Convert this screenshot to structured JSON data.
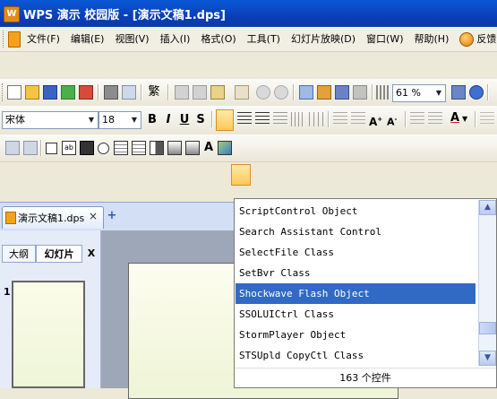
{
  "titlebar": {
    "app_badge": "W",
    "title": "WPS 演示 校园版 - [演示文稿1.dps]"
  },
  "menu": {
    "items": [
      "文件(F)",
      "编辑(E)",
      "视图(V)",
      "插入(I)",
      "格式(O)",
      "工具(T)",
      "幻灯片放映(D)",
      "窗口(W)",
      "帮助(H)"
    ],
    "feedback": "反馈(B)"
  },
  "toolbar1": {
    "glyph_fanti": "繁",
    "zoom_value": "61 %"
  },
  "toolbar2": {
    "font_name": "宋体",
    "font_size": "18",
    "bold": "B",
    "italic": "I",
    "underline": "U",
    "shadow": "S",
    "font_color_glyph": "A"
  },
  "toolbar3": {
    "label_glyph": "A"
  },
  "tabs": {
    "doc_tab": "演示文稿1.dps",
    "close": "×"
  },
  "left_panel": {
    "tab_outline": "大纲",
    "tab_slides": "幻灯片",
    "close": "X",
    "slide_number": "1"
  },
  "dropdown": {
    "items": [
      "ScriptControl Object",
      "Search Assistant Control",
      "SelectFile Class",
      "SetBvr Class",
      "Shockwave Flash Object",
      "SSOLUICtrl Class",
      "StormPlayer Object",
      "STSUpld CopyCtl Class"
    ],
    "selected_index": 4,
    "footer": "163 个控件"
  },
  "colors": {
    "title_bar": "#0a4fc7",
    "selection": "#316ac5",
    "tab_strip": "#d3dff5"
  }
}
